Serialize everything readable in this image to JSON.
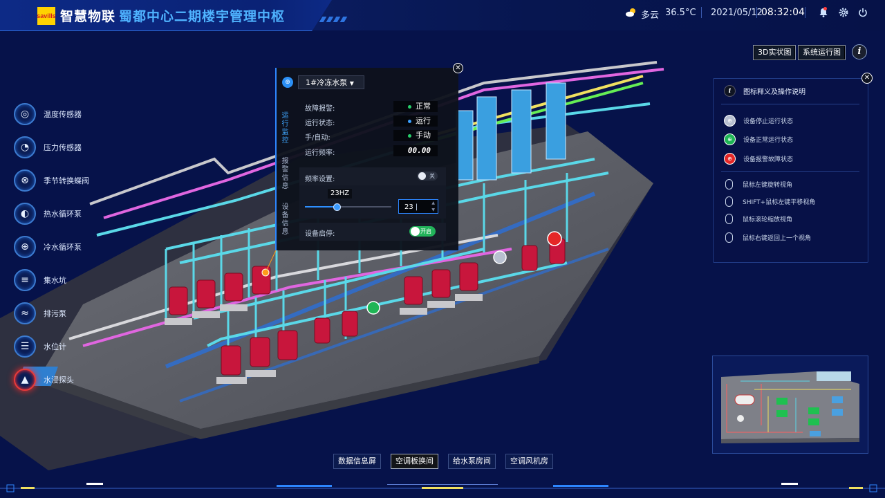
{
  "header": {
    "logo_text": "savills",
    "brand": "智慧物联",
    "system_name": "蜀都中心二期楼宇管理中枢",
    "weather": "多云",
    "temperature": "36.5°C",
    "date": "2021/05/12",
    "time": "08:32:04"
  },
  "view_buttons": [
    "3D实状图",
    "系统运行图"
  ],
  "sidebar": {
    "items": [
      {
        "label": "温度传感器",
        "icon": "thermometer-icon"
      },
      {
        "label": "压力传感器",
        "icon": "gauge-icon"
      },
      {
        "label": "季节转换蝶阀",
        "icon": "valve-icon"
      },
      {
        "label": "热水循环泵",
        "icon": "pump-icon"
      },
      {
        "label": "冷水循环泵",
        "icon": "pump-icon"
      },
      {
        "label": "集水坑",
        "icon": "sump-icon"
      },
      {
        "label": "排污泵",
        "icon": "sewage-pump-icon"
      },
      {
        "label": "水位计",
        "icon": "water-level-icon"
      },
      {
        "label": "水浸探头",
        "icon": "flood-sensor-icon"
      }
    ]
  },
  "popup": {
    "device": "1#冷冻水泵",
    "tabs": [
      "运行监控",
      "报警信息",
      "设备信息"
    ],
    "rows": [
      {
        "label": "故障报警:",
        "value": "正常",
        "dot": "#27d06a"
      },
      {
        "label": "运行状态:",
        "value": "运行",
        "dot": "#3aa0ff"
      },
      {
        "label": "手/自动:",
        "value": "手动",
        "dot": "#27d06a"
      },
      {
        "label": "运行频率:",
        "value": "00.00",
        "dot": ""
      }
    ],
    "freq_label": "频率设置:",
    "freq_toggle": "关",
    "slider_value": "23HZ",
    "slider_fraction": 0.37,
    "input_value": "23",
    "start_label": "设备启停:",
    "start_toggle": "开启"
  },
  "legend": {
    "title": "图标释义及操作说明",
    "status": [
      {
        "label": "设备停止运行状态",
        "color": "#b8c0d0"
      },
      {
        "label": "设备正常运行状态",
        "color": "#1fb555"
      },
      {
        "label": "设备报警故障状态",
        "color": "#e52727"
      }
    ],
    "operations": [
      "鼠标左键旋转视角",
      "SHIFT+鼠标左键平移视角",
      "鼠标滚轮缩放视角",
      "鼠标右键返回上一个视角"
    ]
  },
  "bottom_nav": [
    "数据信息屏",
    "空调板换间",
    "给水泵房间",
    "空调风机房"
  ],
  "bottom_nav_active": 1,
  "colors": {
    "accent": "#2d86ff",
    "alarm": "#e52727",
    "normal": "#1fb555",
    "stopped": "#b8c0d0"
  }
}
